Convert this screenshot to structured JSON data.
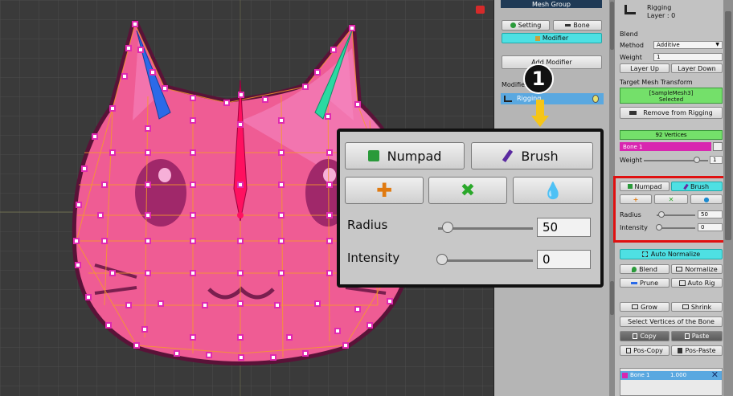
{
  "mid_panel": {
    "title": "Mesh Group",
    "setting_label": "Setting",
    "bone_label": "Bone",
    "modifier_label": "Modifier",
    "add_modifier_label": "Add Modifier",
    "modifier_section_label": "Modifier",
    "rigging_item_label": "Rigging"
  },
  "callout": {
    "number": "1"
  },
  "zoom": {
    "numpad_label": "Numpad",
    "brush_label": "Brush",
    "radius_label": "Radius",
    "radius_value": "50",
    "intensity_label": "Intensity",
    "intensity_value": "0",
    "radius_slider_fraction": 0.1,
    "intensity_slider_fraction": 0.0
  },
  "right_panel": {
    "title": "Rigging",
    "layer": "Layer : 0",
    "blend_label": "Blend",
    "method_label": "Method",
    "method_value": "Additive",
    "weight_label": "Weight",
    "weight_value": "1",
    "layer_up": "Layer Up",
    "layer_down": "Layer Down",
    "target_label": "Target Mesh Transform",
    "target_name": "[SampleMesh3]",
    "target_state": "Selected",
    "remove_rigging": "Remove from Rigging",
    "vertices": "92 Vertices",
    "bone_name": "Bone 1",
    "bone_weight_label": "Weight",
    "bone_weight_value": "1",
    "numpad": "Numpad",
    "brush": "Brush",
    "radius_label": "Radius",
    "radius_value": "50",
    "intensity_label": "Intensity",
    "intensity_value": "0",
    "auto_normalize": "Auto Normalize",
    "blend": "Blend",
    "normalize": "Normalize",
    "prune": "Prune",
    "auto_rig": "Auto Rig",
    "grow": "Grow",
    "shrink": "Shrink",
    "select_vertices": "Select Vertices of the Bone",
    "copy": "Copy",
    "paste": "Paste",
    "pos_copy": "Pos-Copy",
    "pos_paste": "Pos-Paste",
    "bone_list_name": "Bone 1",
    "bone_list_value": "1.000"
  },
  "colors": {
    "accent_cyan": "#4ee0e3",
    "vertex_magenta": "#e02ab0",
    "highlight_red": "#e01010",
    "selected_green": "#74e06a"
  }
}
